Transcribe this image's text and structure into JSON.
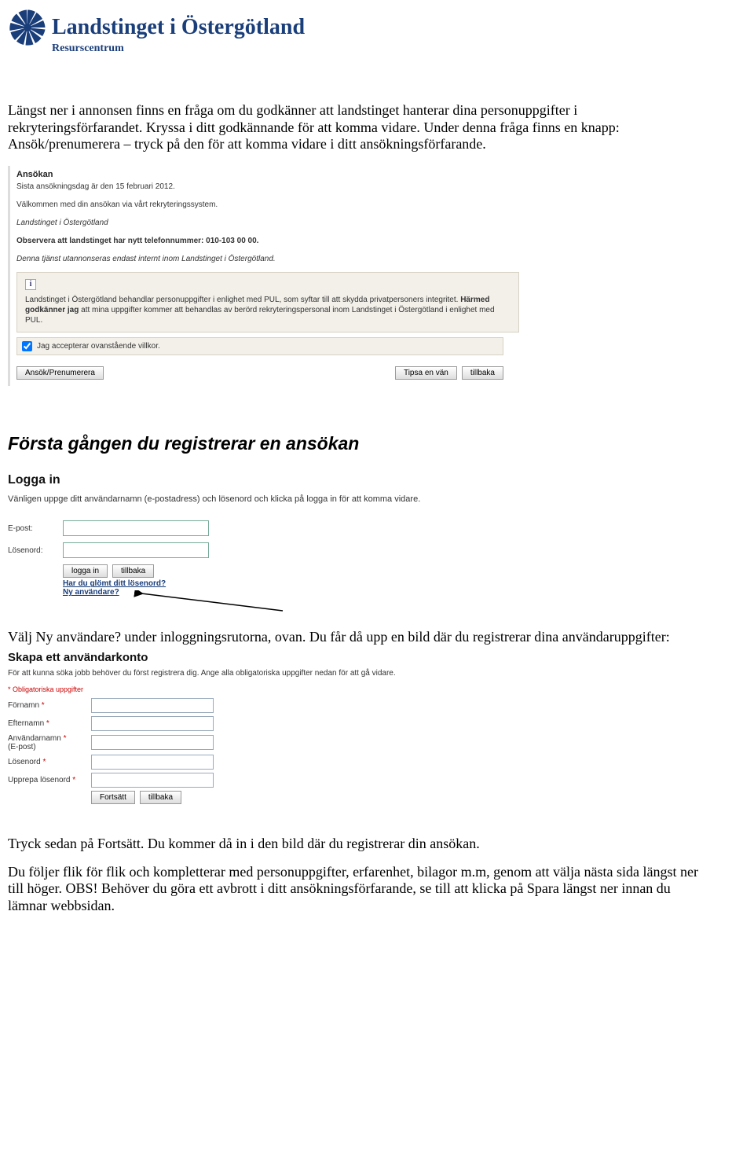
{
  "logo": {
    "title": "Landstinget i Östergötland",
    "subtitle": "Resurscentrum"
  },
  "intro": {
    "p1": "Längst ner i annonsen finns en fråga om du godkänner att landstinget hanterar dina personuppgifter i rekryteringsförfarandet. Kryssa i ditt godkännande för att komma vidare. Under denna fråga finns en knapp: Ansök/prenumerera – tryck på den för att komma vidare i ditt ansökningsförfarande."
  },
  "shot1": {
    "heading": "Ansökan",
    "deadline": "Sista ansökningsdag är den 15 februari 2012.",
    "welcome": "Välkommen med din ansökan via vårt rekryteringssystem.",
    "org": "Landstinget i Östergötland",
    "notice_bold": "Observera att landstinget har nytt telefonnummer: 010-103 00 00.",
    "internal": "Denna tjänst utannonseras endast internt inom Landstinget i Östergötland.",
    "pul_pre": "Landstinget i Östergötland behandlar personuppgifter i enlighet med PUL, som syftar till att skydda privatpersoners integritet. ",
    "pul_bold": "Härmed godkänner jag",
    "pul_post": " att mina uppgifter kommer att behandlas av berörd rekryteringspersonal inom Landstinget i Östergötland i enlighet med PUL.",
    "accept": "Jag accepterar ovanstående villkor.",
    "btn_apply": "Ansök/Prenumerera",
    "btn_tip": "Tipsa en vän",
    "btn_back": "tillbaka"
  },
  "section_heading": "Första gången du registrerar en ansökan",
  "shot2": {
    "heading": "Logga in",
    "instr": "Vänligen uppge ditt användarnamn (e-postadress) och lösenord och klicka på logga in för att komma vidare.",
    "lbl_email": "E-post:",
    "lbl_pw": "Lösenord:",
    "btn_login": "logga in",
    "btn_back": "tillbaka",
    "link_forgot": "Har du glömt ditt lösenord?",
    "link_new": "Ny användare?"
  },
  "mid_para": "Välj Ny användare? under inloggningsrutorna, ovan. Du får då upp en bild där du registrerar dina användaruppgifter:",
  "shot3": {
    "heading": "Skapa ett användarkonto",
    "sub": "För att kunna söka jobb behöver du först registrera dig. Ange alla obligatoriska uppgifter nedan för att gå vidare.",
    "req": "* Obligatoriska uppgifter",
    "lbl_first": "Förnamn",
    "lbl_last": "Efternamn",
    "lbl_user1": "Användarnamn",
    "lbl_user2": "(E-post)",
    "lbl_pw": "Lösenord",
    "lbl_pw2": "Upprepa lösenord",
    "btn_continue": "Fortsätt",
    "btn_back": "tillbaka"
  },
  "outro": {
    "p1": "Tryck sedan på Fortsätt. Du kommer då in i den bild där du registrerar din ansökan.",
    "p2": "Du följer flik för flik och kompletterar med personuppgifter, erfarenhet, bilagor m.m, genom att välja nästa sida längst ner till höger. OBS! Behöver du göra ett avbrott i ditt ansökningsförfarande, se till att klicka på Spara längst ner innan du lämnar webbsidan."
  }
}
